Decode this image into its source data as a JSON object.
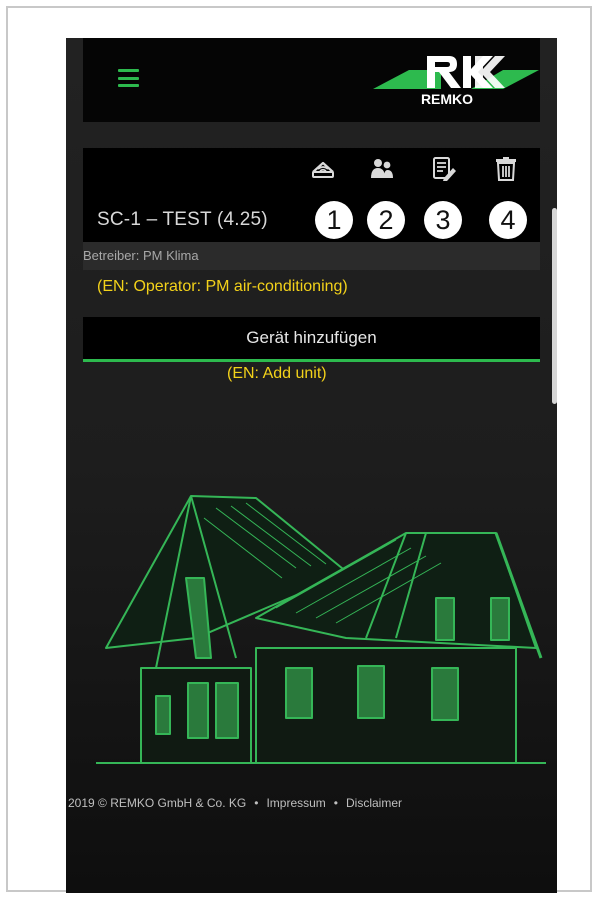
{
  "header": {
    "menu_icon": "hamburger-menu-icon",
    "logo_text": "REMKO",
    "brand_color": "#2dba4e"
  },
  "device": {
    "title": "SC-1 – TEST (4.25)",
    "icons": [
      "router-wifi-icon",
      "users-icon",
      "edit-document-icon",
      "trash-icon"
    ],
    "badges": [
      "1",
      "2",
      "3",
      "4"
    ],
    "operator": "Betreiber: PM Klima",
    "operator_translation": "(EN: Operator: PM air-conditioning)"
  },
  "add_unit": {
    "label": "Gerät hinzufügen",
    "translation": "(EN: Add unit)"
  },
  "footer": {
    "copyright": "2019 © REMKO GmbH & Co. KG",
    "separator": "•",
    "impressum": "Impressum",
    "disclaimer": "Disclaimer"
  },
  "colors": {
    "accent": "#2dba4e",
    "annotation": "#f3d21a",
    "background": "#1d1d1d"
  }
}
